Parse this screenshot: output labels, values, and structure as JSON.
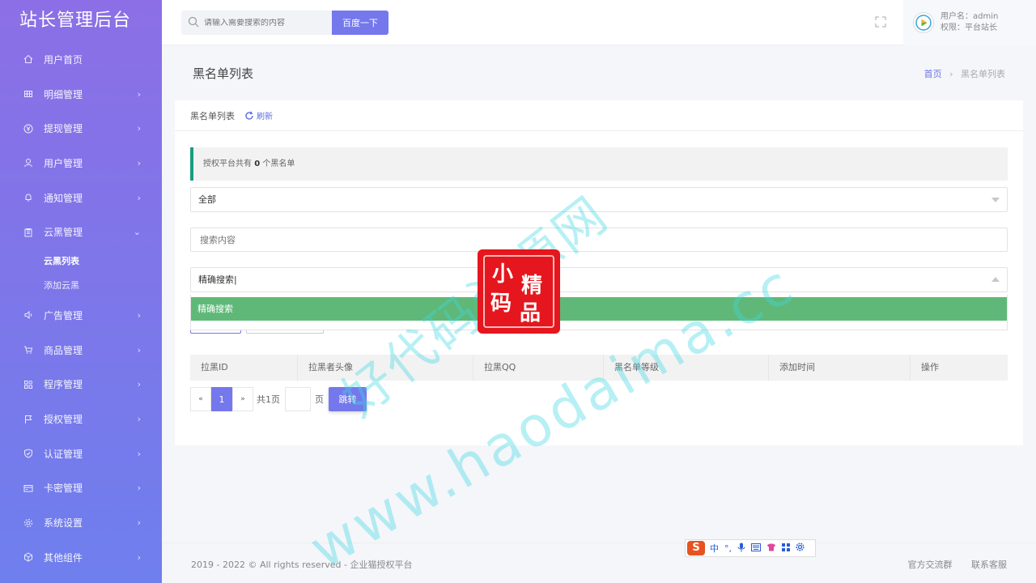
{
  "brand": "站长管理后台",
  "sidebar": {
    "items": [
      {
        "label": "用户首页",
        "icon": "home-icon",
        "chevron": ""
      },
      {
        "label": "明细管理",
        "icon": "grid-icon",
        "chevron": "›"
      },
      {
        "label": "提现管理",
        "icon": "yen-icon",
        "chevron": "›"
      },
      {
        "label": "用户管理",
        "icon": "user-icon",
        "chevron": "›"
      },
      {
        "label": "通知管理",
        "icon": "bell-icon",
        "chevron": "›"
      },
      {
        "label": "云黑管理",
        "icon": "clipboard-icon",
        "chevron": "⌄"
      },
      {
        "label": "广告管理",
        "icon": "speaker-icon",
        "chevron": "›"
      },
      {
        "label": "商品管理",
        "icon": "cart-icon",
        "chevron": "›"
      },
      {
        "label": "程序管理",
        "icon": "apps-icon",
        "chevron": "›"
      },
      {
        "label": "授权管理",
        "icon": "flag-icon",
        "chevron": "›"
      },
      {
        "label": "认证管理",
        "icon": "shield-check-icon",
        "chevron": "›"
      },
      {
        "label": "卡密管理",
        "icon": "card-icon",
        "chevron": "›"
      },
      {
        "label": "系统设置",
        "icon": "gear-icon",
        "chevron": "›"
      },
      {
        "label": "其他组件",
        "icon": "cube-icon",
        "chevron": "›"
      }
    ],
    "sub_items": [
      {
        "label": "云黑列表",
        "active": true
      },
      {
        "label": "添加云黑",
        "active": false
      }
    ]
  },
  "topbar": {
    "search_placeholder": "请输入需要搜索的内容",
    "search_button": "百度一下",
    "user_name": "用户名：admin",
    "user_role": "权限：平台站长"
  },
  "page": {
    "title": "黑名单列表",
    "breadcrumb_home": "首页",
    "breadcrumb_sep": "›",
    "breadcrumb_current": "黑名单列表"
  },
  "card": {
    "head_title": "黑名单列表",
    "refresh_label": "刷新",
    "notice_prefix": "授权平台共有",
    "notice_count": "0",
    "notice_suffix": "个黑名单",
    "filter_select_value": "全部",
    "search_input_placeholder": "搜索内容",
    "mode_select_value": "精确搜索",
    "mode_options": [
      "精确搜索"
    ]
  },
  "table": {
    "columns": [
      "拉黑ID",
      "拉黑者头像",
      "拉黑QQ",
      "黑名单等级",
      "添加时间",
      "操作"
    ]
  },
  "pager": {
    "prev": "«",
    "current": "1",
    "next": "»",
    "total": "共1页",
    "unit": "页",
    "go": "跳转"
  },
  "footer": {
    "copyright": "2019 - 2022 © All rights reserved - 企业猫授权平台",
    "link1": "官方交流群",
    "link2": "联系客服"
  },
  "ime": {
    "logo": "S",
    "lang": "中",
    "punct": "°,"
  },
  "watermark": {
    "line1": "好代码资源网",
    "line2": "www.haodaima.cc",
    "seal_chars": [
      "小",
      "精",
      "码",
      "品"
    ]
  },
  "colors": {
    "accent": "#7478ec",
    "sidebar_top": "#8c6fe6",
    "sidebar_bottom": "#6f7fee",
    "notice_border": "#1a9c82",
    "option_selected": "#5fb878"
  }
}
